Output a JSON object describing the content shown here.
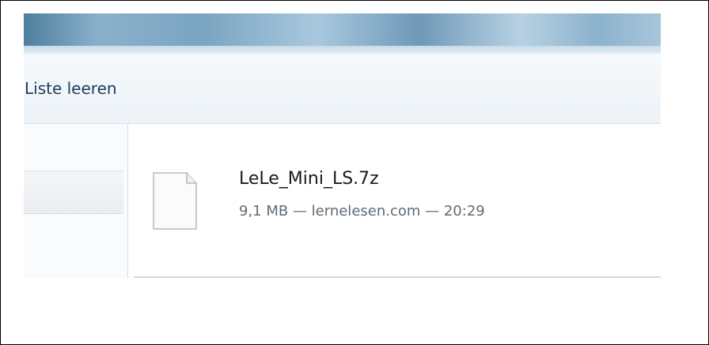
{
  "toolbar": {
    "clear_list_label": "Liste leeren"
  },
  "downloads": [
    {
      "filename": "LeLe_Mini_LS.7z",
      "status_line": "9,1 MB — lernelesen.com — 20:29",
      "size": "9,1 MB",
      "source": "lernelesen.com",
      "time": "20:29",
      "icon": "generic-file-icon"
    }
  ]
}
